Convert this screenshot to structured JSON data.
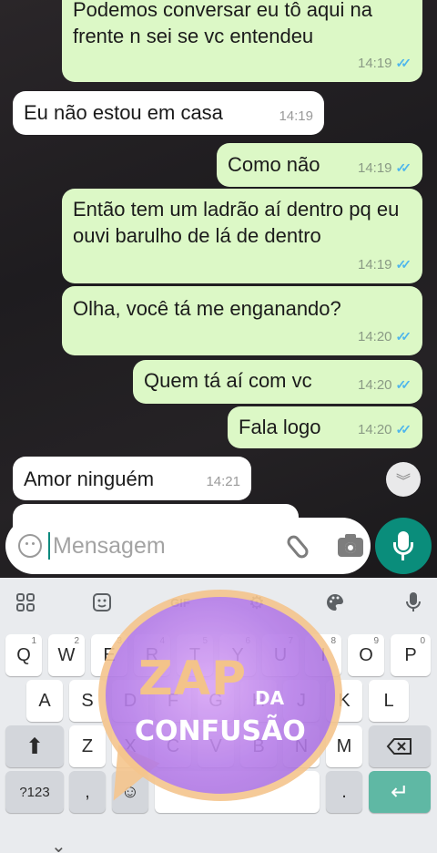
{
  "messages": [
    {
      "text": "Podemos conversar eu tô aqui na frente n sei se vc entendeu",
      "time": "14:19",
      "ticks": "✓✓",
      "direction": "out"
    },
    {
      "text": "Eu não estou em casa",
      "time": "14:19",
      "direction": "in"
    },
    {
      "text": "Como não",
      "time": "14:19",
      "ticks": "✓✓",
      "direction": "out"
    },
    {
      "text": "Então tem um ladrão aí dentro pq eu ouvi barulho de lá de dentro",
      "time": "14:19",
      "ticks": "✓✓",
      "direction": "out"
    },
    {
      "text": "Olha, você tá me enganando?",
      "time": "14:20",
      "ticks": "✓✓",
      "direction": "out"
    },
    {
      "text": "Quem tá aí com vc",
      "time": "14:20",
      "ticks": "✓✓",
      "direction": "out"
    },
    {
      "text": "Fala logo",
      "time": "14:20",
      "ticks": "✓✓",
      "direction": "out"
    },
    {
      "text": "Amor ninguém",
      "time": "14:21",
      "direction": "in"
    }
  ],
  "composer": {
    "placeholder": "Mensagem"
  },
  "keyboard": {
    "toolbar": [
      "apps-icon",
      "sticker-icon",
      "GIF",
      "gear-icon",
      "palette-icon",
      "mic-icon"
    ],
    "gif_label": "GIF",
    "row1": [
      {
        "k": "Q",
        "n": "1"
      },
      {
        "k": "W",
        "n": "2"
      },
      {
        "k": "E",
        "n": "3"
      },
      {
        "k": "R",
        "n": "4"
      },
      {
        "k": "T",
        "n": "5"
      },
      {
        "k": "Y",
        "n": "6"
      },
      {
        "k": "U",
        "n": "7"
      },
      {
        "k": "I",
        "n": "8"
      },
      {
        "k": "O",
        "n": "9"
      },
      {
        "k": "P",
        "n": "0"
      }
    ],
    "row2": [
      "A",
      "S",
      "D",
      "F",
      "G",
      "H",
      "J",
      "K",
      "L"
    ],
    "row3": [
      "Z",
      "X",
      "C",
      "V",
      "B",
      "N",
      "M"
    ],
    "symbols_label": "?123",
    "comma_label": ",",
    "period_label": "."
  },
  "logo": {
    "line1": "ZAP",
    "line2": "DA",
    "line3": "CONFUSÃO"
  },
  "colors": {
    "outgoing_bubble": "#dcf8c6",
    "incoming_bubble": "#ffffff",
    "accent": "#0a8d7b",
    "read_ticks": "#4fb6ec"
  }
}
